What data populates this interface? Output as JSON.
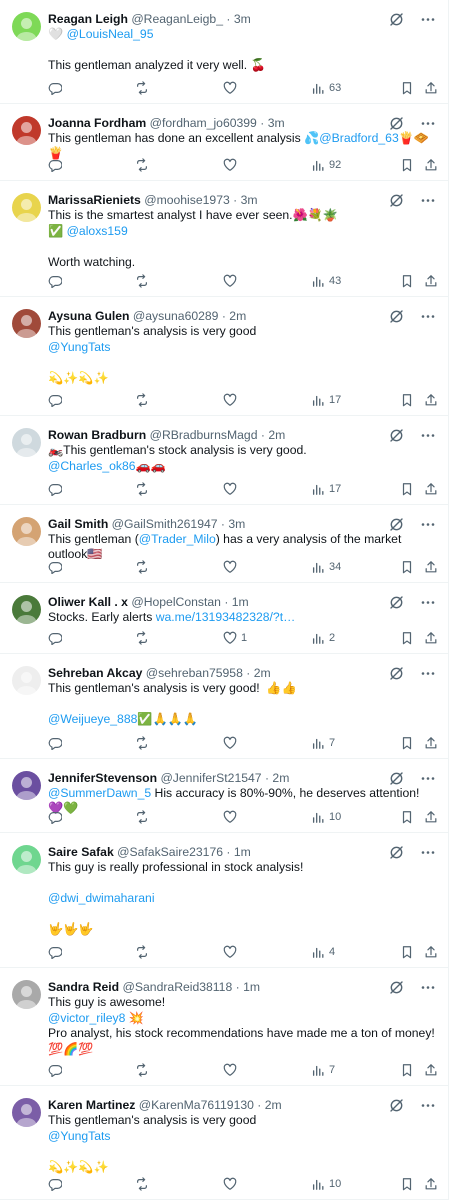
{
  "tweets": [
    {
      "name": "Reagan Leigh",
      "handle": "@ReaganLeigb_",
      "time": "3m",
      "avatar_color": "#7ed957",
      "lines": [
        [
          {
            "t": "🤍 "
          },
          {
            "t": "@LouisNeal_95",
            "link": true
          }
        ],
        [
          {
            "t": ""
          }
        ],
        [
          {
            "t": "This gentleman analyzed it very well. 🍒"
          }
        ]
      ],
      "replies": "",
      "reposts": "",
      "likes": "",
      "views": "63"
    },
    {
      "name": "Joanna Fordham",
      "handle": "@fordham_jo60399",
      "time": "3m",
      "avatar_color": "#c0392b",
      "lines": [
        [
          {
            "t": "This gentleman has done an excellent analysis 💦"
          },
          {
            "t": "@Bradford_63",
            "link": true
          },
          {
            "t": "🍟🧇🍟"
          }
        ]
      ],
      "replies": "",
      "reposts": "",
      "likes": "",
      "views": "92"
    },
    {
      "name": "MarissaRieniets",
      "handle": "@moohise1973",
      "time": "3m",
      "avatar_color": "#e8d44d",
      "lines": [
        [
          {
            "t": "This is the smartest analyst I have ever seen.🌺💐🪴"
          }
        ],
        [
          {
            "t": "✅ "
          },
          {
            "t": "@aloxs159",
            "link": true
          }
        ],
        [
          {
            "t": ""
          }
        ],
        [
          {
            "t": "Worth watching."
          }
        ]
      ],
      "replies": "",
      "reposts": "",
      "likes": "",
      "views": "43"
    },
    {
      "name": "Aysuna Gulen",
      "handle": "@aysuna60289",
      "time": "2m",
      "avatar_color": "#a04a3a",
      "lines": [
        [
          {
            "t": "This gentleman's analysis is very good"
          }
        ],
        [
          {
            "t": "@YungTats",
            "link": true
          }
        ],
        [
          {
            "t": ""
          }
        ],
        [
          {
            "t": "💫✨💫✨"
          }
        ]
      ],
      "replies": "",
      "reposts": "",
      "likes": "",
      "views": "17"
    },
    {
      "name": "Rowan Bradburn",
      "handle": "@RBradburnsMagd",
      "time": "2m",
      "avatar_color": "#cfd9de",
      "lines": [
        [
          {
            "t": "🏍️This gentleman's stock analysis is very good."
          }
        ],
        [
          {
            "t": "@Charles_ok86",
            "link": true
          },
          {
            "t": "🚗🚗"
          }
        ]
      ],
      "replies": "",
      "reposts": "",
      "likes": "",
      "views": "17"
    },
    {
      "name": "Gail Smith",
      "handle": "@GailSmith261947",
      "time": "3m",
      "avatar_color": "#d4a373",
      "lines": [
        [
          {
            "t": "This gentleman ("
          },
          {
            "t": "@Trader_Milo",
            "link": true
          },
          {
            "t": ") has a very analysis of the market outlook🇺🇸"
          }
        ]
      ],
      "replies": "",
      "reposts": "",
      "likes": "",
      "views": "34"
    },
    {
      "name": "Oliwer Kall . x",
      "handle": "@HopelConstan",
      "time": "1m",
      "avatar_color": "#4a7a3a",
      "lines": [
        [
          {
            "t": "Stocks. Early alerts "
          },
          {
            "t": "wa.me/13193482328/?t…",
            "link": true
          }
        ]
      ],
      "replies": "",
      "reposts": "",
      "likes": "1",
      "views": "2"
    },
    {
      "name": "Sehreban Akcay",
      "handle": "@sehreban75958",
      "time": "2m",
      "avatar_color": "#eeeeee",
      "lines": [
        [
          {
            "t": "This gentleman's analysis is very good!  👍👍"
          }
        ],
        [
          {
            "t": ""
          }
        ],
        [
          {
            "t": "@Weijueye_888",
            "link": true
          },
          {
            "t": "✅🙏🙏🙏"
          }
        ]
      ],
      "replies": "",
      "reposts": "",
      "likes": "",
      "views": "7"
    },
    {
      "name": "JenniferStevenson",
      "handle": "@JenniferSt21547",
      "time": "2m",
      "avatar_color": "#6b4fa0",
      "lines": [
        [
          {
            "t": "@SummerDawn_5",
            "link": true
          },
          {
            "t": " His accuracy is 80%-90%, he deserves attention! 💜💚"
          }
        ]
      ],
      "replies": "",
      "reposts": "",
      "likes": "",
      "views": "10"
    },
    {
      "name": "Saire Safak",
      "handle": "@SafakSaire23176",
      "time": "1m",
      "avatar_color": "#6fd68f",
      "lines": [
        [
          {
            "t": "This guy is really professional in stock analysis!"
          }
        ],
        [
          {
            "t": ""
          }
        ],
        [
          {
            "t": "@dwi_dwimaharani",
            "link": true
          }
        ],
        [
          {
            "t": ""
          }
        ],
        [
          {
            "t": "🤟🤟🤟"
          }
        ]
      ],
      "replies": "",
      "reposts": "",
      "likes": "",
      "views": "4"
    },
    {
      "name": "Sandra Reid",
      "handle": "@SandraReid38118",
      "time": "1m",
      "avatar_color": "#a9a9a9",
      "lines": [
        [
          {
            "t": "This guy is awesome!"
          }
        ],
        [
          {
            "t": "@victor_riley8",
            "link": true
          },
          {
            "t": " 💥"
          }
        ],
        [
          {
            "t": "Pro analyst, his stock recommendations have made me a ton of money!"
          }
        ],
        [
          {
            "t": "💯🌈💯"
          }
        ]
      ],
      "replies": "",
      "reposts": "",
      "likes": "",
      "views": "7"
    },
    {
      "name": "Karen Martinez",
      "handle": "@KarenMa76119130",
      "time": "2m",
      "avatar_color": "#7b5ea7",
      "lines": [
        [
          {
            "t": "This gentleman's analysis is very good"
          }
        ],
        [
          {
            "t": "@YungTats",
            "link": true
          }
        ],
        [
          {
            "t": ""
          }
        ],
        [
          {
            "t": "💫✨💫✨"
          }
        ]
      ],
      "replies": "",
      "reposts": "",
      "likes": "",
      "views": "10"
    }
  ],
  "icons": {
    "reply": "reply-icon",
    "repost": "repost-icon",
    "like": "heart-icon",
    "views": "views-icon",
    "bookmark": "bookmark-icon",
    "share": "share-icon",
    "grok": "grok-icon",
    "more": "more-icon"
  },
  "colors": {
    "text": "#0f1419",
    "secondary": "#536471",
    "link": "#1d9bf0",
    "border": "#eff3f4"
  }
}
